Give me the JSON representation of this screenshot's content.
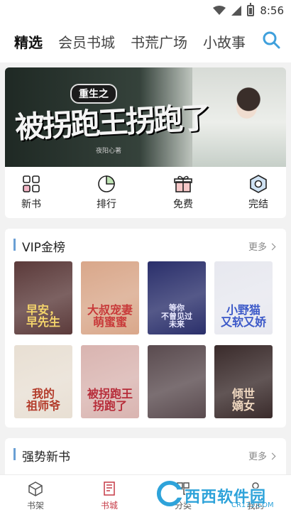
{
  "status": {
    "time": "8:56"
  },
  "tabs": [
    {
      "label": "精选",
      "active": true
    },
    {
      "label": "会员书城"
    },
    {
      "label": "书荒广场"
    },
    {
      "label": "小故事"
    }
  ],
  "banner": {
    "subtitle": "重生之",
    "title": "被拐跑王拐跑了",
    "author": "夜阳心著"
  },
  "shortcuts": [
    {
      "label": "新书",
      "icon": "new-book-icon"
    },
    {
      "label": "排行",
      "icon": "ranking-icon"
    },
    {
      "label": "免费",
      "icon": "gift-icon"
    },
    {
      "label": "完结",
      "icon": "finished-icon"
    }
  ],
  "vip": {
    "title": "VIP金榜",
    "more": "更多",
    "books": [
      {
        "cover_text": "早安，\n早先生",
        "color": "#5b3a3a",
        "text_color": "#f5d56b"
      },
      {
        "cover_text": "大叔宠妻\n萌蜜蜜",
        "color": "#d9a78a",
        "text_color": "#c83a3a"
      },
      {
        "cover_text": "等你\n不曾见过\n未来",
        "color": "#2a2f6b",
        "text_color": "#e9e9ff"
      },
      {
        "cover_text": "小野猫\n又软又娇",
        "color": "#e7e8ef",
        "text_color": "#3b58c8"
      },
      {
        "cover_text": "我的\n祖师爷",
        "color": "#e8dfd3",
        "text_color": "#b33b2a"
      },
      {
        "cover_text": "被拐跑王\n拐跑了",
        "color": "#d9b4b0",
        "text_color": "#b72d3a"
      },
      {
        "cover_text": "",
        "color": "#5a4b4f",
        "text_color": "#fff"
      },
      {
        "cover_text": "倾世\n嫡女",
        "color": "#3a2b2b",
        "text_color": "#f0d8c0"
      }
    ]
  },
  "strong": {
    "title": "强势新书",
    "more": "更多"
  },
  "nav": [
    {
      "label": "书架",
      "icon": "bookshelf-icon"
    },
    {
      "label": "书城",
      "icon": "bookstore-icon",
      "active": true
    },
    {
      "label": "分类",
      "icon": "category-icon"
    },
    {
      "label": "我的",
      "icon": "profile-icon"
    }
  ],
  "watermark": {
    "text": "西西软件园",
    "url": "CR173.COM"
  }
}
